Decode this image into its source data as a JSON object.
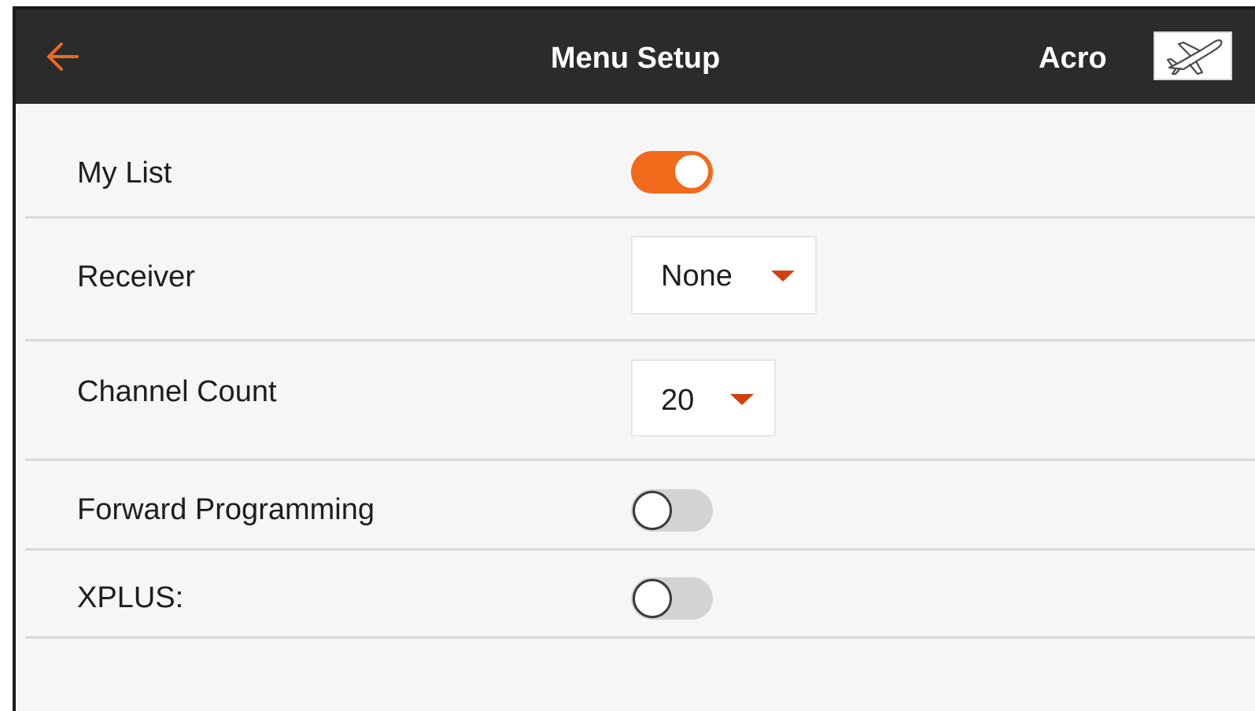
{
  "header": {
    "title": "Menu Setup",
    "model_name": "Acro",
    "back_icon": "arrow-left-icon",
    "model_icon": "airplane-icon"
  },
  "rows": [
    {
      "label": "My List",
      "control": "toggle",
      "state": "on"
    },
    {
      "label": "Receiver",
      "control": "dropdown",
      "value": "None"
    },
    {
      "label": "Channel Count",
      "control": "dropdown",
      "value": "20"
    },
    {
      "label": "Forward Programming",
      "control": "toggle",
      "state": "off"
    },
    {
      "label": "XPLUS:",
      "control": "toggle",
      "state": "off"
    }
  ],
  "colors": {
    "header_bg": "#2b2b2b",
    "accent": "#f26a1b",
    "caret": "#d2400e",
    "content_bg": "#f6f6f6"
  }
}
